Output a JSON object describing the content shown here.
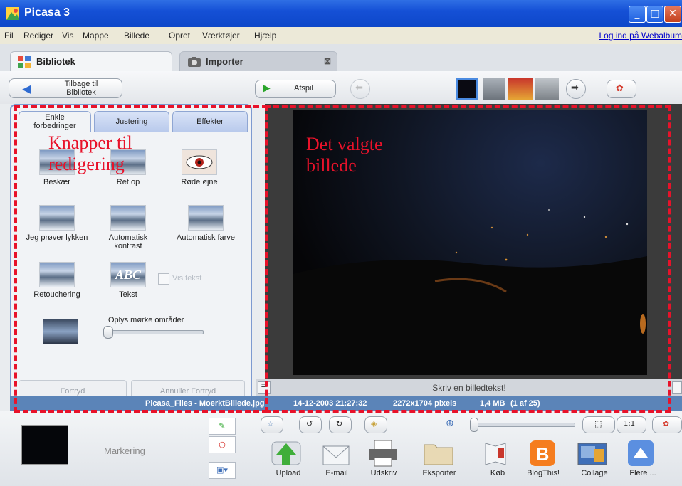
{
  "window": {
    "title": "Picasa 3"
  },
  "menu": {
    "items": [
      "Fil",
      "Rediger",
      "Vis",
      "Mappe",
      "Billede",
      "Opret",
      "Værktøjer",
      "Hjælp"
    ],
    "login": "Log ind på Webalbum"
  },
  "tabs": [
    {
      "label": "Bibliotek"
    },
    {
      "label": "Importer"
    }
  ],
  "toolbar": {
    "back_line1": "Tilbage til",
    "back_line2": "Bibliotek",
    "play": "Afspil"
  },
  "edit_tabs": [
    {
      "line1": "Enkle",
      "line2": "forbedringer"
    },
    {
      "line1": "Justering",
      "line2": ""
    },
    {
      "line1": "Effekter",
      "line2": ""
    }
  ],
  "tools": {
    "crop": "Beskær",
    "straighten": "Ret op",
    "redeye": "Røde øjne",
    "lucky": "Jeg prøver lykken",
    "autocontrast_1": "Automatisk",
    "autocontrast_2": "kontrast",
    "autocolor": "Automatisk farve",
    "retouch": "Retouchering",
    "text": "Tekst",
    "text_thumb": "ABC",
    "show_text": "Vis tekst",
    "fill_light": "Oplys mørke områder"
  },
  "fill_light_level": 0.05,
  "panel_buttons": {
    "undo": "Fortryd",
    "redo": "Annuller Fortryd"
  },
  "caption": "Skriv en billedtekst!",
  "status": {
    "filename": "Picasa_Files - MoerktBillede.jpg",
    "date": "14-12-2003 21:27:32",
    "dimensions": "2272x1704 pixels",
    "size": "1,4 MB",
    "position": "(1 af 25)"
  },
  "bottom": {
    "selection": "Markering",
    "actions": [
      "Upload",
      "E-mail",
      "Udskriv",
      "Eksporter",
      "Køb",
      "BlogThis!",
      "Collage",
      "Flere ..."
    ],
    "zoom_label": "1:1"
  },
  "annotations": {
    "left": "Knapper til redigering",
    "right": "Det valgte billede"
  },
  "colors": {
    "annotation": "#e8122a",
    "status": "#5b84b8",
    "titlebar": "#1550d6"
  }
}
